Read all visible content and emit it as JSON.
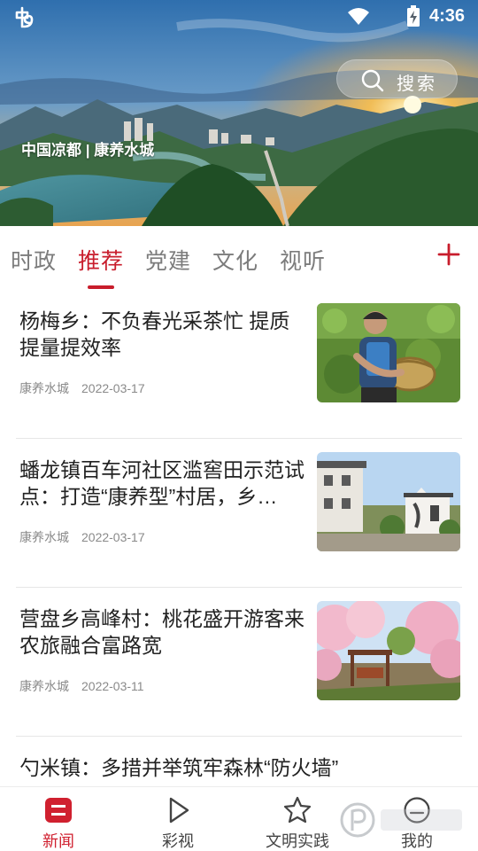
{
  "status_bar": {
    "time": "4:36",
    "icons": [
      "app-logo-icon",
      "wifi-icon",
      "battery-charging-icon"
    ]
  },
  "hero": {
    "caption": "中国凉都 | 康养水城",
    "search": {
      "label": "搜索",
      "icon": "search-icon"
    }
  },
  "tabs": {
    "items": [
      {
        "label": "时政",
        "active": false
      },
      {
        "label": "推荐",
        "active": true
      },
      {
        "label": "党建",
        "active": false
      },
      {
        "label": "文化",
        "active": false
      },
      {
        "label": "视听",
        "active": false
      }
    ],
    "add_icon": "plus-icon",
    "accent_color": "#c81d2c"
  },
  "news": [
    {
      "title": "杨梅乡：不负春光采茶忙 提质提量提效率",
      "source": "康养水城",
      "date": "2022-03-17",
      "thumbnail": "tea-picking-photo"
    },
    {
      "title": "蟠龙镇百车河社区滥窖田示范试点：打造“康养型”村居，乡…",
      "source": "康养水城",
      "date": "2022-03-17",
      "thumbnail": "village-houses-photo"
    },
    {
      "title": "营盘乡高峰村：桃花盛开游客来 农旅融合富路宽",
      "source": "康养水城",
      "date": "2022-03-11",
      "thumbnail": "peach-blossom-photo"
    },
    {
      "title": "勺米镇：多措并举筑牢森林“防火墙”"
    }
  ],
  "bottom_nav": [
    {
      "label": "新闻",
      "icon": "news-icon",
      "active": true
    },
    {
      "label": "彩视",
      "icon": "play-icon",
      "active": false
    },
    {
      "label": "文明实践",
      "icon": "star-icon",
      "active": false
    },
    {
      "label": "我的",
      "icon": "profile-icon",
      "active": false
    }
  ],
  "colors": {
    "accent": "#c81d2c",
    "text_primary": "#222222",
    "text_secondary": "#8a8a8a",
    "tab_inactive": "#7c7c7c"
  }
}
